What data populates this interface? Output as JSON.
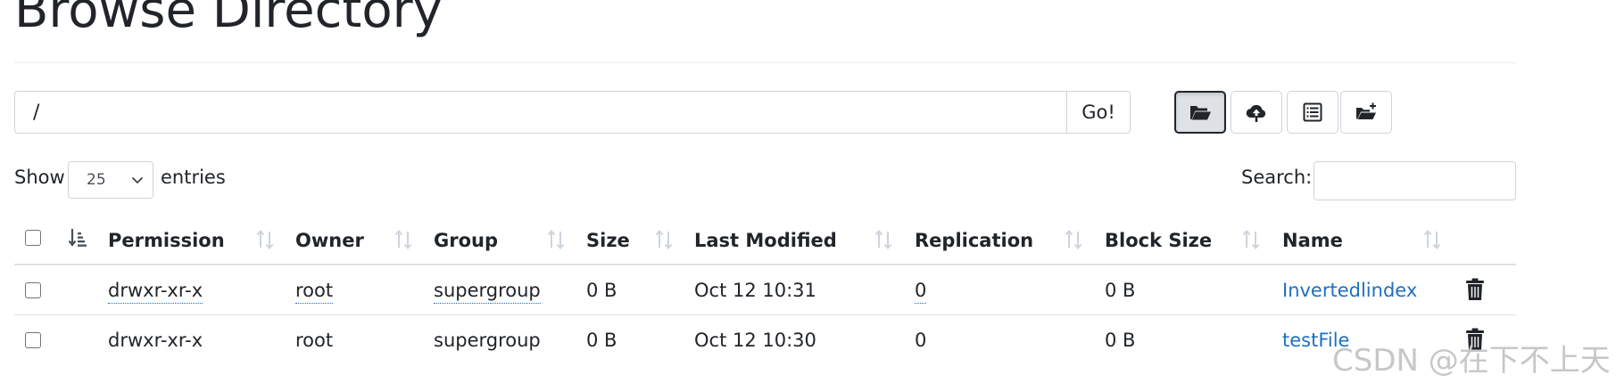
{
  "page": {
    "title": "Browse Directory"
  },
  "path_bar": {
    "value": "/",
    "go_label": "Go!"
  },
  "toolbar": {
    "buttons": [
      {
        "name": "open-directory",
        "icon": "folder-open-icon",
        "active": true
      },
      {
        "name": "upload-file",
        "icon": "cloud-upload-icon",
        "active": false
      },
      {
        "name": "cut-paste",
        "icon": "list-alt-icon",
        "active": false
      },
      {
        "name": "create-directory",
        "icon": "folder-plus-icon",
        "active": false
      }
    ]
  },
  "length_menu": {
    "show_label": "Show",
    "selected": "25",
    "entries_label": "entries"
  },
  "search": {
    "label": "Search:",
    "value": ""
  },
  "table": {
    "columns": [
      "Permission",
      "Owner",
      "Group",
      "Size",
      "Last Modified",
      "Replication",
      "Block Size",
      "Name"
    ],
    "rows": [
      {
        "permission": "drwxr-xr-x",
        "owner": "root",
        "group": "supergroup",
        "size": "0 B",
        "last_modified": "Oct 12 10:31",
        "replication": "0",
        "block_size": "0 B",
        "name": "Invertedlindex"
      },
      {
        "permission": "drwxr-xr-x",
        "owner": "root",
        "group": "supergroup",
        "size": "0 B",
        "last_modified": "Oct 12 10:30",
        "replication": "0",
        "block_size": "0 B",
        "name": "testFile"
      }
    ]
  },
  "watermark": "CSDN @在下不上天",
  "colors": {
    "link": "#1f6fbf",
    "border": "#ced4da",
    "text": "#212529"
  }
}
